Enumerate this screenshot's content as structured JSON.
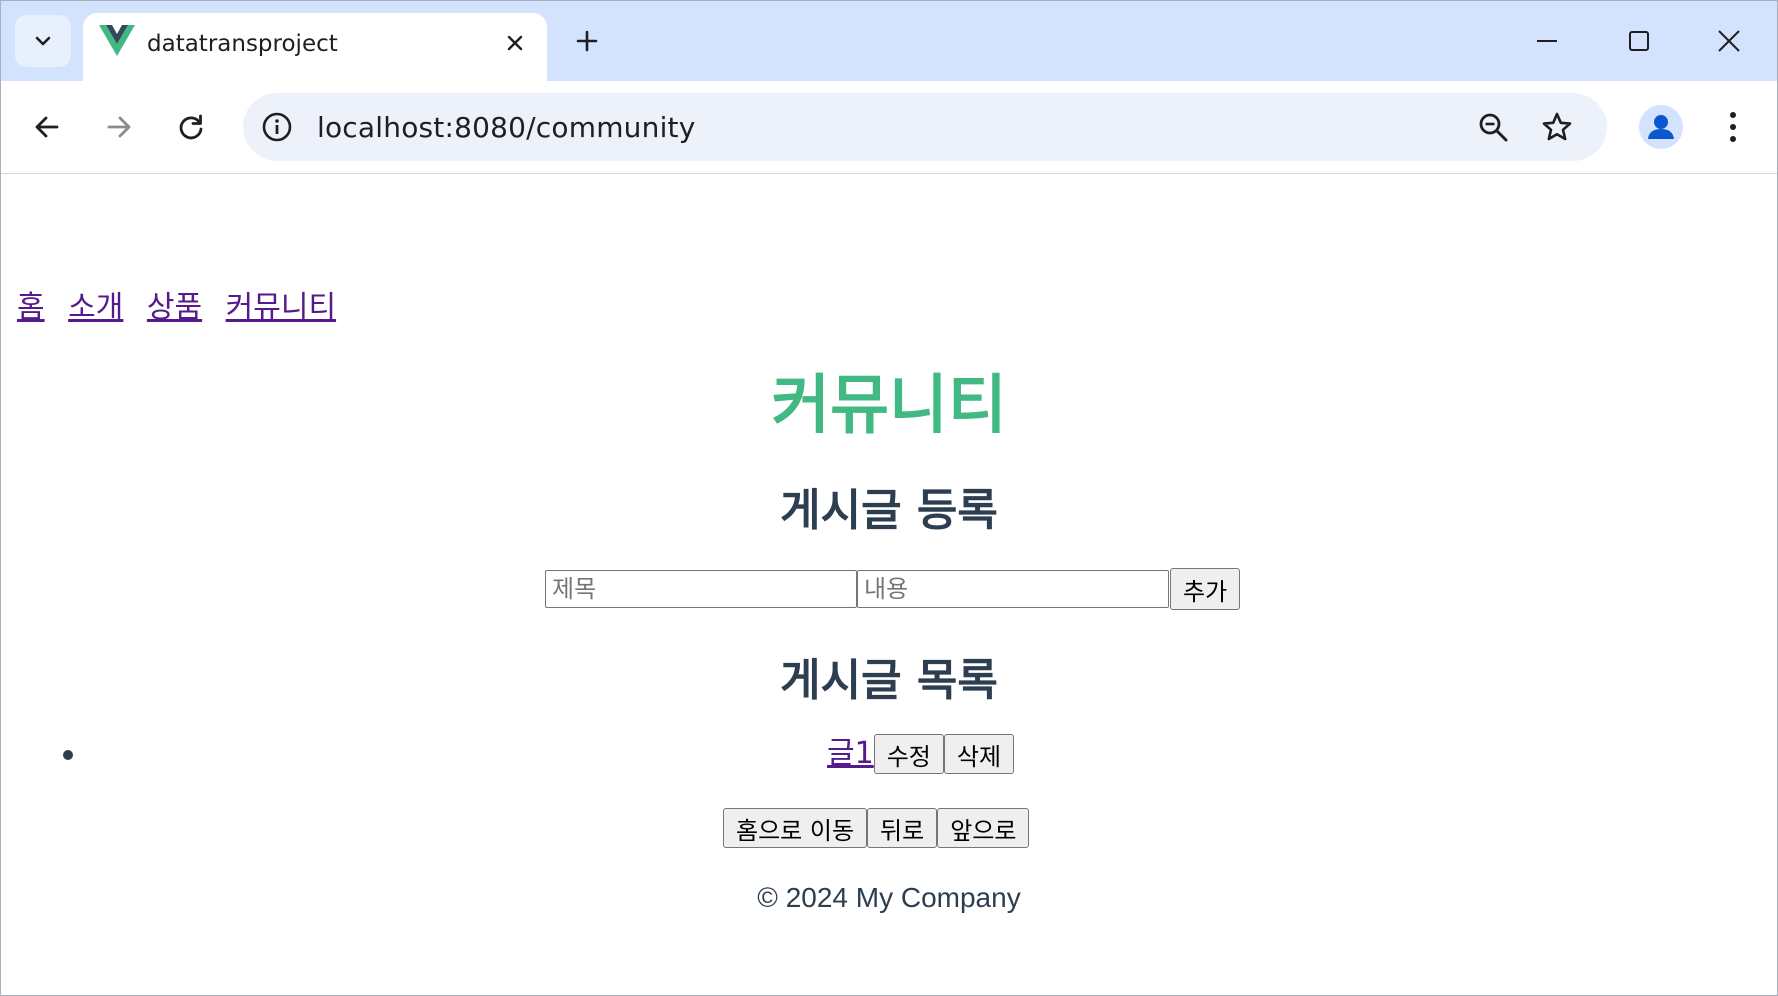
{
  "browser": {
    "tab": {
      "title": "datatransproject"
    },
    "omnibox": {
      "url": "localhost:8080/community"
    },
    "colors": {
      "tabstrip": "#d3e3fd",
      "omnibox": "#edf1fa",
      "profile_icon": "#0b57d0",
      "favicon_green": "#41b883",
      "favicon_dark": "#34495e"
    },
    "icons": {
      "tab_search": "chevron-down-icon",
      "tab_close": "close-icon",
      "new_tab": "plus-icon",
      "minimize": "minimize-icon",
      "maximize": "maximize-icon",
      "close": "close-icon",
      "back": "arrow-left-icon",
      "forward": "arrow-right-icon",
      "reload": "reload-icon",
      "site_info": "info-icon",
      "zoom": "zoom-out-icon",
      "bookmark": "star-icon",
      "profile": "person-icon",
      "menu": "more-vert-icon"
    }
  },
  "page": {
    "nav": [
      "홈",
      "소개",
      "상품",
      "커뮤니티"
    ],
    "title": "커뮤니티",
    "register_heading": "게시글 등록",
    "form": {
      "title_placeholder": "제목",
      "content_placeholder": "내용",
      "add_label": "추가"
    },
    "list_heading": "게시글 목록",
    "posts": [
      {
        "title": "글1",
        "edit_label": "수정",
        "delete_label": "삭제"
      }
    ],
    "bottom_buttons": {
      "home": "홈으로 이동",
      "back": "뒤로",
      "forward": "앞으로"
    },
    "footer": "© 2024 My Company",
    "colors": {
      "title": "#42b983",
      "text": "#2c3e50",
      "link": "#551a8b"
    }
  }
}
